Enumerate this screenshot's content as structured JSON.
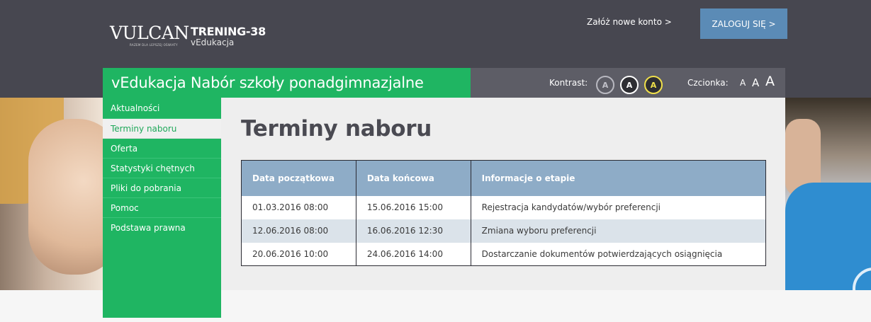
{
  "header": {
    "logo_text": "VULCAN",
    "logo_tagline": "RAZEM DLA LEPSZEJ OŚWIATY",
    "app_title": "TRENING-38",
    "app_subtitle": "vEdukacja",
    "new_account_link": "Załóż nowe konto >",
    "login_button": "ZALOGUJ SIĘ >"
  },
  "module_title": "vEdukacja Nabór szkoły ponadgimnazjalne",
  "accessibility": {
    "contrast_label": "Kontrast:",
    "contrast_options": [
      "A",
      "A",
      "A"
    ],
    "font_label": "Czcionka:",
    "font_sizes": [
      "A",
      "A",
      "A"
    ]
  },
  "sidebar": {
    "items": [
      {
        "label": "Aktualności",
        "active": false
      },
      {
        "label": "Terminy naboru",
        "active": true
      },
      {
        "label": "Oferta",
        "active": false
      },
      {
        "label": "Statystyki chętnych",
        "active": false
      },
      {
        "label": "Pliki do pobrania",
        "active": false
      },
      {
        "label": "Pomoc",
        "active": false
      },
      {
        "label": "Podstawa prawna",
        "active": false
      }
    ]
  },
  "main": {
    "page_title": "Terminy naboru",
    "table": {
      "headers": [
        "Data początkowa",
        "Data końcowa",
        "Informacje o etapie"
      ],
      "rows": [
        [
          "01.03.2016 08:00",
          "15.06.2016 15:00",
          "Rejestracja kandydatów/wybór preferencji"
        ],
        [
          "12.06.2016 08:00",
          "16.06.2016 12:30",
          "Zmiana wyboru preferencji"
        ],
        [
          "20.06.2016 10:00",
          "24.06.2016 14:00",
          "Dostarczanie dokumentów potwierdzających osiągnięcia"
        ]
      ]
    }
  },
  "colors": {
    "header_bg": "#474750",
    "brand_green": "#1fb562",
    "login_blue": "#5b8bb6",
    "table_header": "#8eacc7",
    "contrast_yellow": "#f0e04a"
  }
}
